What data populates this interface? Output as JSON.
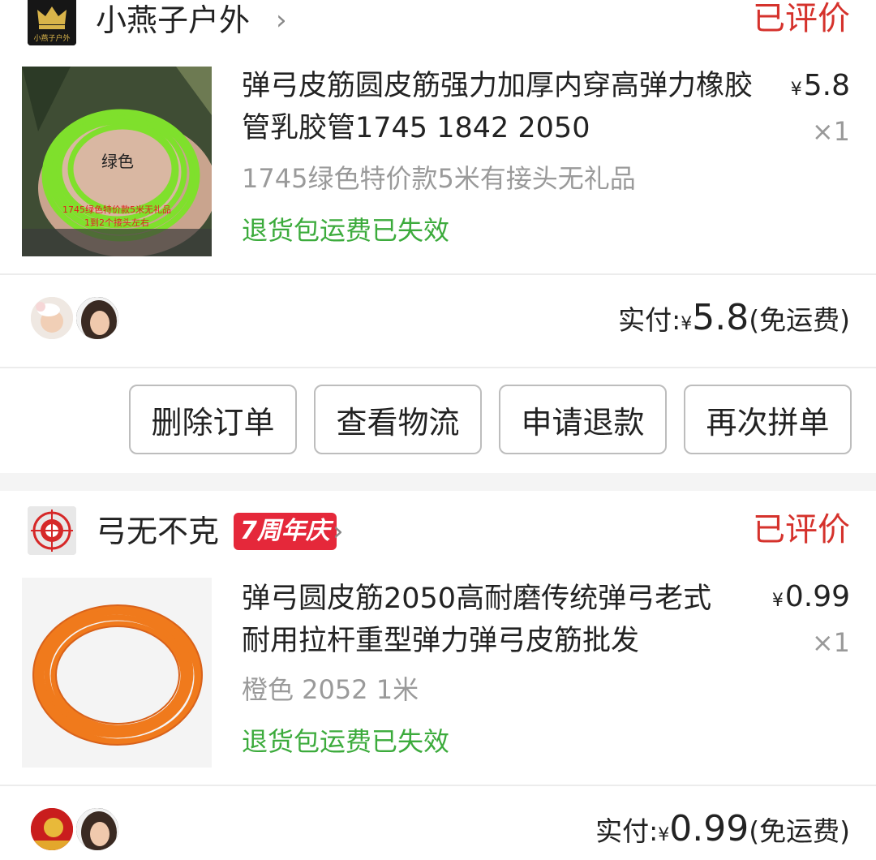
{
  "orders": [
    {
      "store": {
        "name": "小燕子户外",
        "logo_text": "小燕子户外"
      },
      "status": "已评价",
      "item": {
        "title": "弹弓皮筋圆皮筋强力加厚内穿高弹力橡胶管乳胶管1745 1842 2050",
        "spec": "1745绿色特价款5米有接头无礼品",
        "policy": "退货包运费已失效",
        "price_symbol": "¥",
        "price": "5.8",
        "qty": "×1",
        "thumb_label": "绿色",
        "thumb_caption_1": "1745绿色特价款5米无礼品",
        "thumb_caption_2": "1到2个接头左右"
      },
      "paid": {
        "label": "实付:",
        "symbol": "¥",
        "amount": "5.8",
        "note": "(免运费)"
      },
      "buttons": [
        "删除订单",
        "查看物流",
        "申请退款",
        "再次拼单"
      ]
    },
    {
      "store": {
        "name": "弓无不克",
        "badge": "7周年庆"
      },
      "status": "已评价",
      "item": {
        "title": "弹弓圆皮筋2050高耐磨传统弹弓老式耐用拉杆重型弹力弹弓皮筋批发",
        "spec": "橙色 2052 1米",
        "policy": "退货包运费已失效",
        "price_symbol": "¥",
        "price": "0.99",
        "qty": "×1"
      },
      "paid": {
        "label": "实付:",
        "symbol": "¥",
        "amount": "0.99",
        "note": "(免运费)"
      }
    }
  ],
  "colors": {
    "status": "#d5322c",
    "policy": "#3cab3c",
    "badge": "#e5283a",
    "spec": "#9a9a9a"
  },
  "icons": [
    "crown-logo-icon",
    "target-logo-icon",
    "chevron-right-icon"
  ]
}
